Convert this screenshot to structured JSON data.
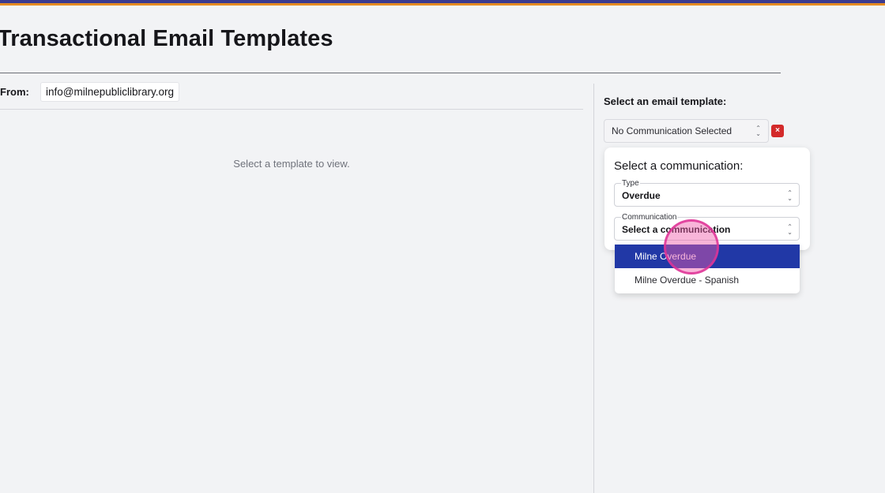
{
  "colors": {
    "top_stripe_primary": "#3b3a8f",
    "top_stripe_secondary": "#e58b22",
    "menu_highlight": "#2138a6",
    "clear_button": "#d32a2a",
    "click_indicator": "#ec5aad"
  },
  "page": {
    "title": "Transactional Email Templates"
  },
  "from": {
    "label": "From:",
    "value": "info@milnepubliclibrary.org"
  },
  "preview": {
    "placeholder": "Select a template to view."
  },
  "template_panel": {
    "title": "Select an email template:",
    "selected_template": "No Communication Selected",
    "clear_icon": "×"
  },
  "communication_card": {
    "heading": "Select a communication:",
    "type_field": {
      "label": "Type",
      "value": "Overdue"
    },
    "communication_field": {
      "label": "Communication",
      "value": "Select a communication"
    }
  },
  "dropdown": {
    "options": [
      {
        "label": "Milne Overdue",
        "highlighted": true
      },
      {
        "label": "Milne Overdue - Spanish",
        "highlighted": false
      }
    ]
  },
  "icons": {
    "select_chevrons": "chevron-up-down-icon",
    "clear": "close-icon"
  }
}
